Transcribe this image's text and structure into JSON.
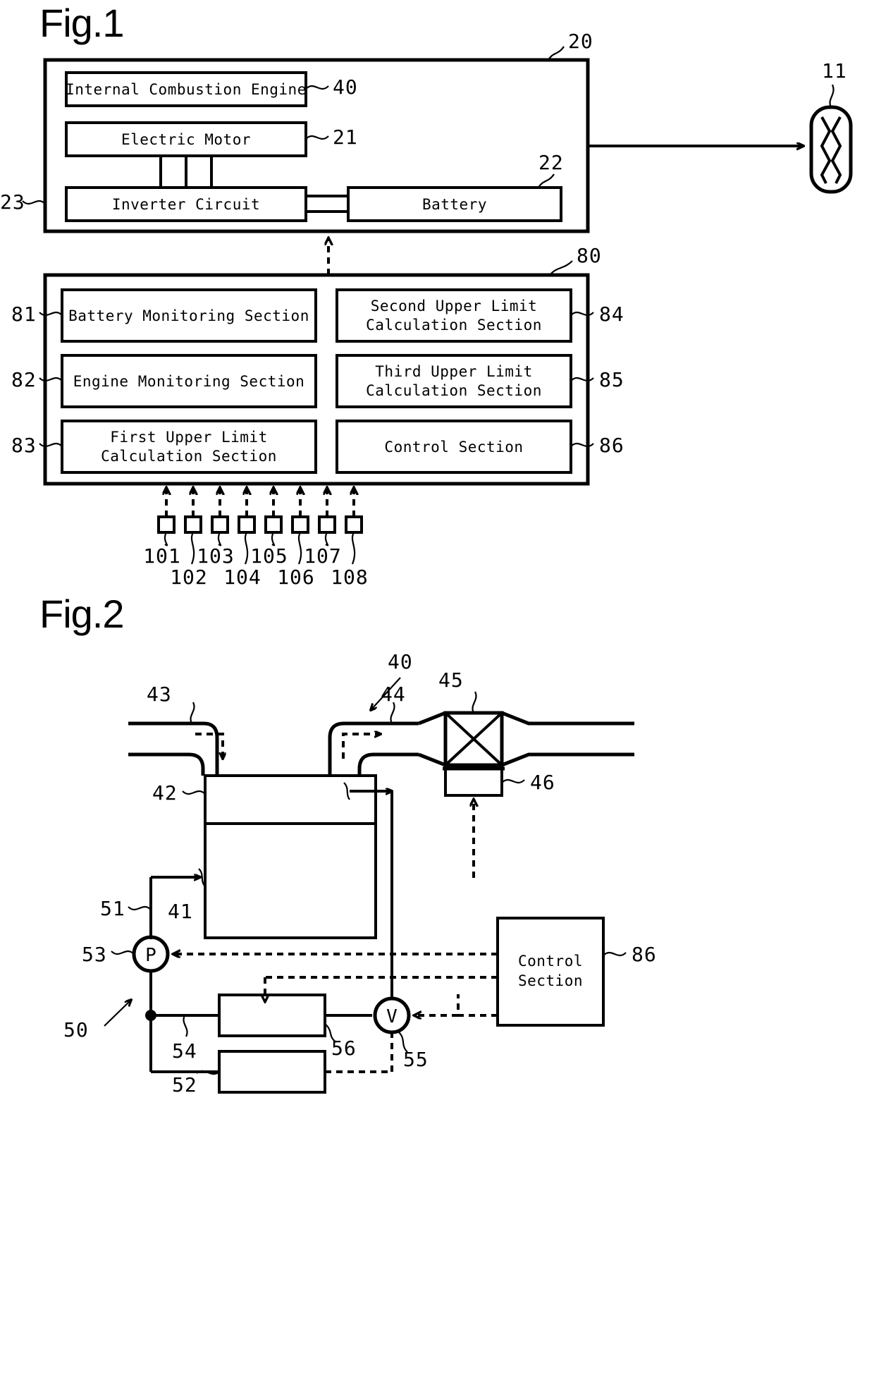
{
  "figures": [
    {
      "title": "Fig.1",
      "caption_ref": "20",
      "vehicle": {
        "ref": "20",
        "blocks": [
          {
            "ref": "40",
            "label": "Internal Combustion Engine"
          },
          {
            "ref": "21",
            "label": "Electric Motor"
          },
          {
            "ref": "23",
            "label": "Inverter Circuit"
          },
          {
            "ref": "22",
            "label": "Battery"
          }
        ],
        "wheel_ref": "11"
      },
      "controller": {
        "ref": "80",
        "left_blocks": [
          {
            "ref": "81",
            "label": "Battery Monitoring Section"
          },
          {
            "ref": "82",
            "label": "Engine Monitoring Section"
          },
          {
            "ref": "83",
            "label": "First Upper Limit\nCalculation Section"
          }
        ],
        "right_blocks": [
          {
            "ref": "84",
            "label": "Second Upper Limit\nCalculation Section"
          },
          {
            "ref": "85",
            "label": "Third Upper Limit\nCalculation Section"
          },
          {
            "ref": "86",
            "label": "Control Section"
          }
        ],
        "sensors_top_row": [
          "101",
          "103",
          "105",
          "107"
        ],
        "sensors_bottom_row": [
          "102",
          "104",
          "106",
          "108"
        ],
        "sensor_count": 8
      }
    },
    {
      "title": "Fig.2",
      "engine_ref": "40",
      "refs": {
        "intake_pipe": "43",
        "exhaust_pipe": "44",
        "catalyst": "45",
        "sensor_46": "46",
        "engine_body": "42",
        "cylinder": "41",
        "fuel_system": "50",
        "pump_line": "51",
        "return_line": "52",
        "pump": "53",
        "branch_line": "54",
        "valve_v": "55",
        "injector_block": "56",
        "control_section": "86"
      },
      "pump_symbol": "P",
      "valve_symbol": "V",
      "control_box_label": "Control\nSection",
      "control_box_lines": [
        "Control",
        "Section"
      ]
    }
  ],
  "colors": {
    "ink": "#000000",
    "paper": "#ffffff"
  }
}
